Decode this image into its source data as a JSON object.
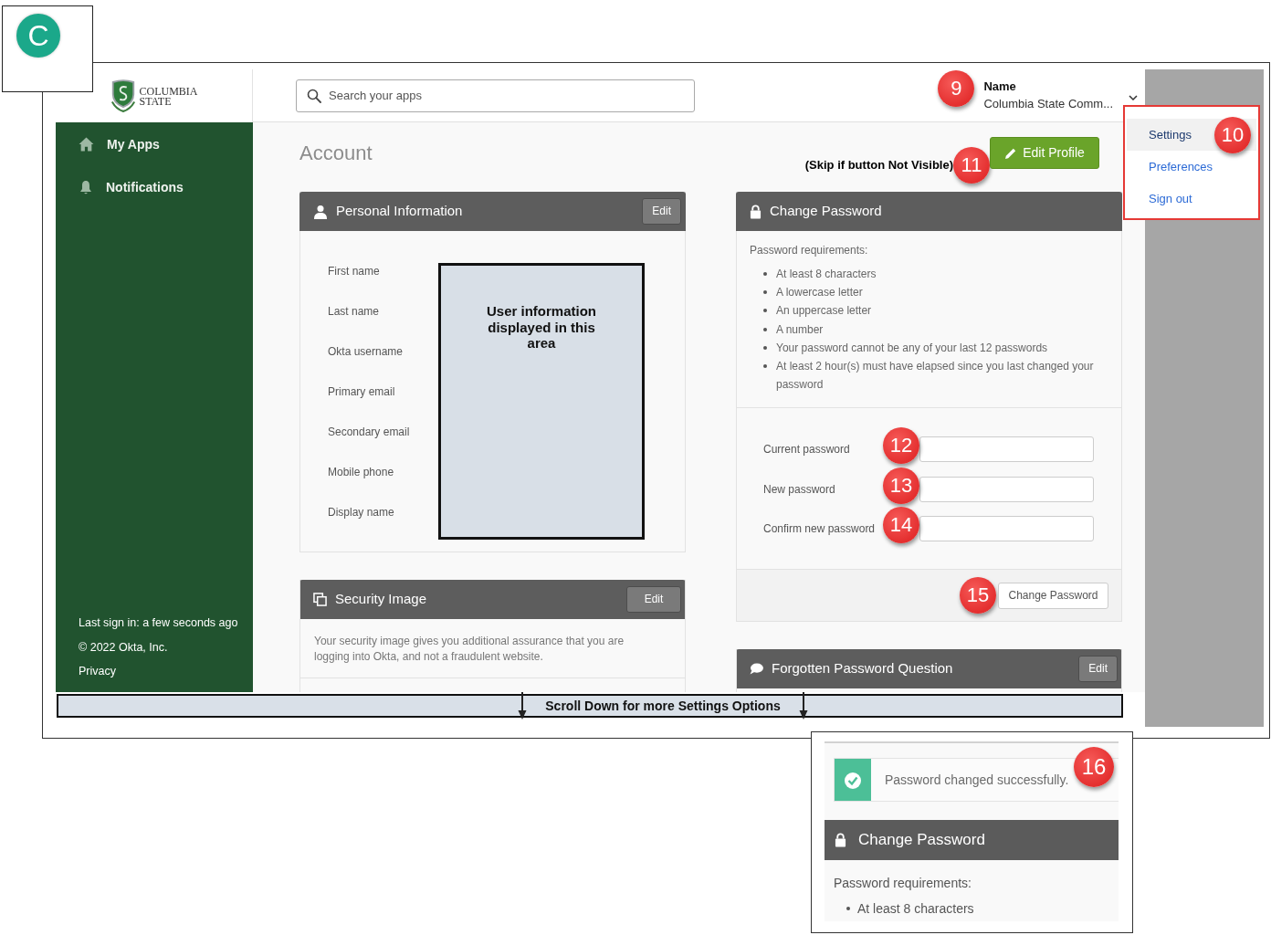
{
  "corner_tab": {
    "letter": "C"
  },
  "logo": {
    "line_1": "COLUMBIA",
    "line_2": "STATE"
  },
  "header": {
    "search": {
      "placeholder": "Search your apps"
    },
    "user": {
      "callout": "9",
      "name": "Name",
      "organization": "Columbia State Comm..."
    }
  },
  "user_menu": {
    "callout": "10",
    "items": [
      {
        "label": "Settings",
        "selected": true
      },
      {
        "label": "Preferences",
        "selected": false
      },
      {
        "label": "Sign out",
        "selected": false
      }
    ]
  },
  "sidebar": {
    "items": [
      {
        "label": "My Apps"
      },
      {
        "label": "Notifications"
      }
    ],
    "footer": {
      "last_sign_in": "Last sign in: a few seconds ago",
      "copyright": "© 2022 Okta, Inc.",
      "privacy_link": "Privacy"
    }
  },
  "page": {
    "title": "Account",
    "note": "(Skip if button Not Visible)",
    "note_callout": "11",
    "edit_profile_button": "Edit Profile"
  },
  "personal_information": {
    "title": "Personal Information",
    "edit_button": "Edit",
    "fields": [
      "First name",
      "Last name",
      "Okta username",
      "Primary email",
      "Secondary email",
      "Mobile phone",
      "Display name"
    ],
    "placeholder_note": "User information displayed in this area"
  },
  "security_image": {
    "title": "Security Image",
    "edit_button": "Edit",
    "description": "Your security image gives you additional assurance that you are logging into Okta, and not a fraudulent website."
  },
  "change_password": {
    "title": "Change Password",
    "requirements_heading": "Password requirements:",
    "requirements": [
      "At least 8 characters",
      "A lowercase letter",
      "An uppercase letter",
      "A number",
      "Your password cannot be any of your last 12 passwords",
      "At least 2 hour(s) must have elapsed since you last changed your password"
    ],
    "fields": [
      {
        "label": "Current password",
        "callout": "12"
      },
      {
        "label": "New password",
        "callout": "13"
      },
      {
        "label": "Confirm new password",
        "callout": "14"
      }
    ],
    "submit_callout": "15",
    "submit_button": "Change Password"
  },
  "forgotten_password_question": {
    "title": "Forgotten Password Question",
    "edit_button": "Edit"
  },
  "scroll_banner": {
    "text": "Scroll Down for more Settings Options"
  },
  "inset": {
    "alert": "Password changed successfully.",
    "callout": "16",
    "title": "Change Password",
    "requirements_heading": "Password requirements:",
    "requirements": [
      "At least 8 characters"
    ]
  }
}
